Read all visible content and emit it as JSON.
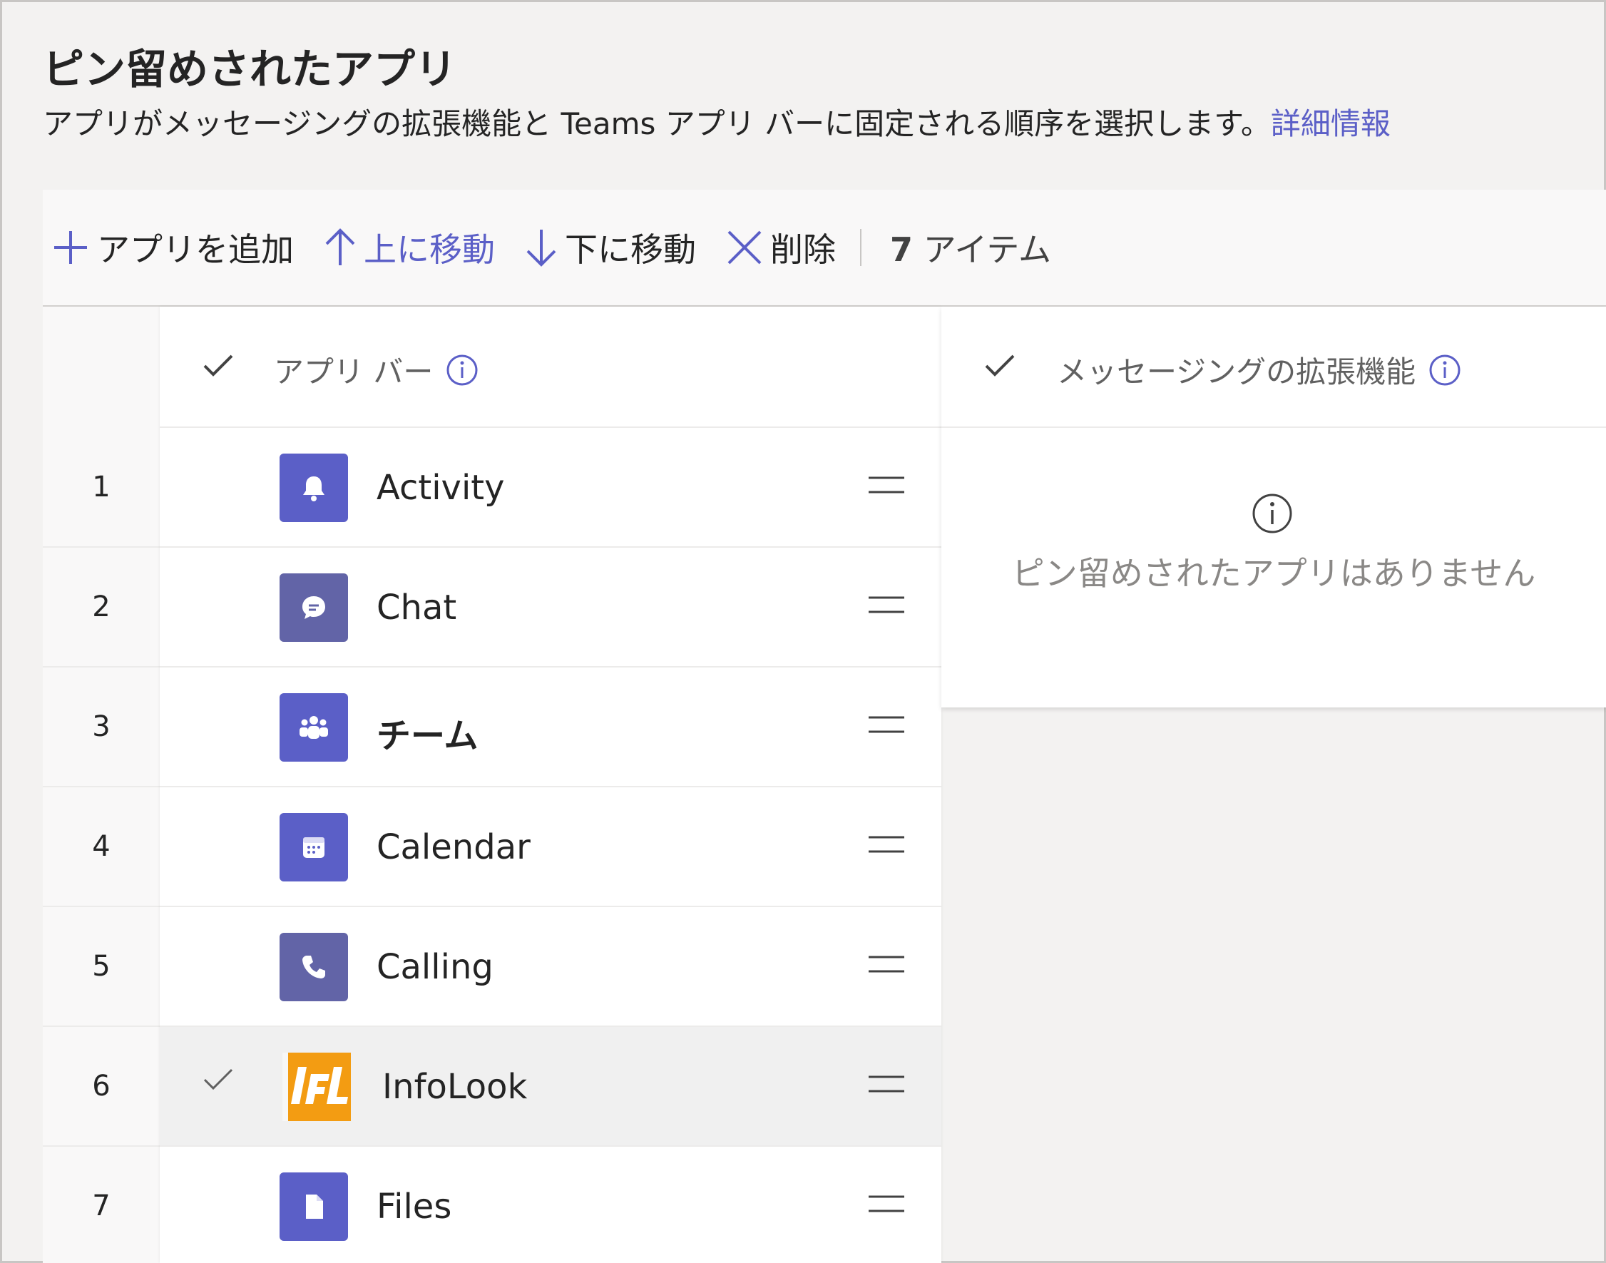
{
  "page": {
    "title": "ピン留めされたアプリ",
    "description": "アプリがメッセージングの拡張機能と Teams アプリ バーに固定される順序を選択します。",
    "learn_more": "詳細情報"
  },
  "toolbar": {
    "add_label": "アプリを追加",
    "move_up_label": "上に移動",
    "move_down_label": "下に移動",
    "delete_label": "削除",
    "item_count": "7",
    "item_count_suffix": " アイテム"
  },
  "app_bar": {
    "header": "アプリ バー",
    "rows": [
      {
        "num": "1",
        "name": "Activity",
        "icon": "bell-icon",
        "color": "#5b5fc7",
        "selected": false
      },
      {
        "num": "2",
        "name": "Chat",
        "icon": "chat-icon",
        "color": "#6264a7",
        "selected": false
      },
      {
        "num": "3",
        "name": "チーム",
        "icon": "teams-icon",
        "color": "#5b5fc7",
        "selected": false
      },
      {
        "num": "4",
        "name": "Calendar",
        "icon": "calendar-icon",
        "color": "#5b5fc7",
        "selected": false
      },
      {
        "num": "5",
        "name": "Calling",
        "icon": "phone-icon",
        "color": "#6264a7",
        "selected": false
      },
      {
        "num": "6",
        "name": "InfoLook",
        "icon": "infolook-logo",
        "color": "#f39c12",
        "selected": true
      },
      {
        "num": "7",
        "name": "Files",
        "icon": "file-icon",
        "color": "#5b5fc7",
        "selected": false
      }
    ]
  },
  "message_extensions": {
    "header": "メッセージングの拡張機能",
    "empty_text": "ピン留めされたアプリはありません"
  },
  "colors": {
    "accent": "#5b5fc7",
    "background": "#f3f2f1",
    "infolook": "#f39c12"
  }
}
